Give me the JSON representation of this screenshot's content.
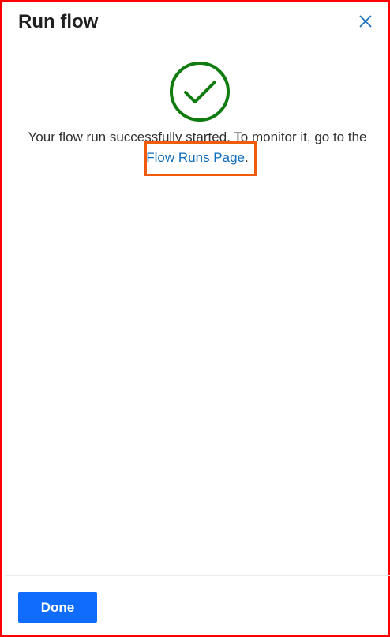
{
  "panel": {
    "title": "Run flow",
    "close_icon": "close-icon"
  },
  "status": {
    "icon": "checkmark-circle-icon",
    "icon_color": "#107c10",
    "message_prefix": "Your flow run successfully started. To monitor it, go to the",
    "link_text": "Flow Runs Page",
    "message_suffix": "."
  },
  "footer": {
    "done_label": "Done"
  },
  "colors": {
    "accent": "#0f6cfd",
    "link": "#0f6cbd",
    "highlight": "#f25b0a",
    "border": "#ff0000"
  }
}
